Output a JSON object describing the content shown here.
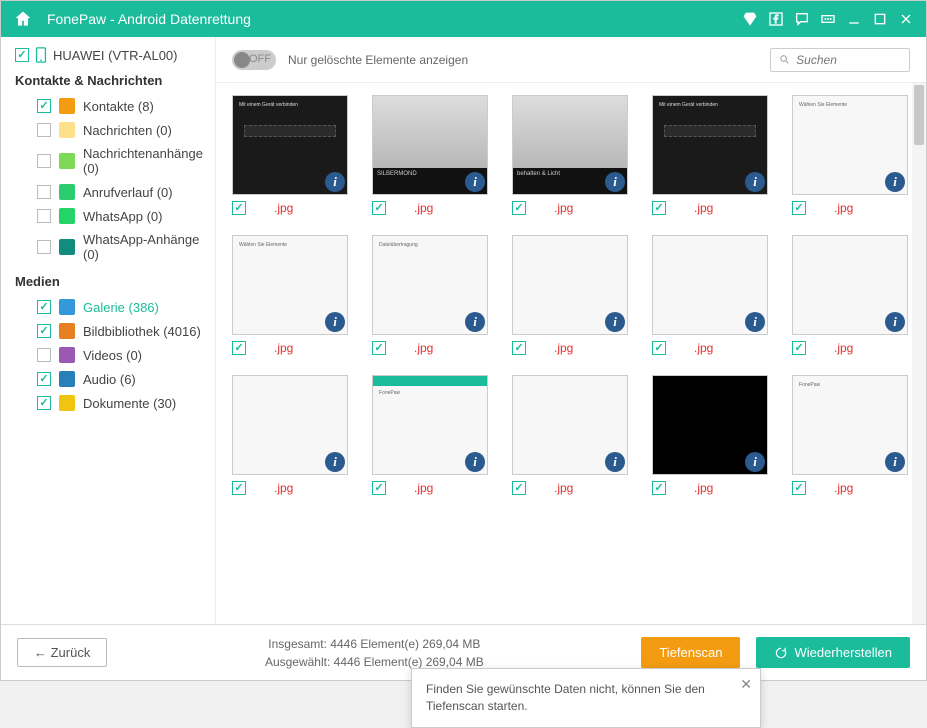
{
  "title": "FonePaw - Android Datenrettung",
  "device": {
    "name": "HUAWEI (VTR-AL00)"
  },
  "sections": {
    "contacts_header": "Kontakte & Nachrichten",
    "media_header": "Medien"
  },
  "categories_contacts": [
    {
      "label": "Kontakte (8)",
      "checked": true,
      "icon": "ic-orange"
    },
    {
      "label": "Nachrichten (0)",
      "checked": false,
      "icon": "ic-yellow"
    },
    {
      "label": "Nachrichtenanhänge (0)",
      "checked": false,
      "icon": "ic-lime"
    },
    {
      "label": "Anrufverlauf (0)",
      "checked": false,
      "icon": "ic-green"
    },
    {
      "label": "WhatsApp (0)",
      "checked": false,
      "icon": "ic-wa"
    },
    {
      "label": "WhatsApp-Anhänge (0)",
      "checked": false,
      "icon": "ic-wa2"
    }
  ],
  "categories_media": [
    {
      "label": "Galerie (386)",
      "checked": true,
      "icon": "ic-gal",
      "selected": true
    },
    {
      "label": "Bildbibliothek (4016)",
      "checked": true,
      "icon": "ic-lib"
    },
    {
      "label": "Videos (0)",
      "checked": false,
      "icon": "ic-vid"
    },
    {
      "label": "Audio (6)",
      "checked": true,
      "icon": "ic-aud"
    },
    {
      "label": "Dokumente (30)",
      "checked": true,
      "icon": "ic-doc"
    }
  ],
  "toggle": {
    "state": "OFF",
    "label": "Nur gelöschte Elemente anzeigen"
  },
  "search_placeholder": "Suchen",
  "thumbs": [
    {
      "ext": ".jpg",
      "variant": "dark",
      "hint": "Mit einem Gerät verbinden"
    },
    {
      "ext": ".jpg",
      "variant": "band",
      "hint": "SILBERMOND"
    },
    {
      "ext": ".jpg",
      "variant": "band",
      "hint": "behalten & Licht"
    },
    {
      "ext": ".jpg",
      "variant": "dark",
      "hint": "Mit einem Gerät verbinden"
    },
    {
      "ext": ".jpg",
      "variant": "light",
      "hint": "Wählen Sie Elemente"
    },
    {
      "ext": ".jpg",
      "variant": "light",
      "hint": "Wählen Sie Elemente"
    },
    {
      "ext": ".jpg",
      "variant": "light",
      "hint": "Dateiübertragung"
    },
    {
      "ext": ".jpg",
      "variant": "light",
      "hint": ""
    },
    {
      "ext": ".jpg",
      "variant": "light",
      "hint": ""
    },
    {
      "ext": ".jpg",
      "variant": "light",
      "hint": ""
    },
    {
      "ext": ".jpg",
      "variant": "light",
      "hint": ""
    },
    {
      "ext": ".jpg",
      "variant": "lighthdr",
      "hint": "FonePaw"
    },
    {
      "ext": ".jpg",
      "variant": "light",
      "hint": ""
    },
    {
      "ext": ".jpg",
      "variant": "black",
      "hint": ""
    },
    {
      "ext": ".jpg",
      "variant": "light",
      "hint": "FonePaw"
    }
  ],
  "footer": {
    "back": "←   Zurück",
    "total_line": "Insgesamt: 4446 Element(e) 269,04 MB",
    "selected_line": "Ausgewählt: 4446 Element(e) 269,04 MB",
    "deepscan": "Tiefenscan",
    "recover": "Wiederherstellen"
  },
  "tooltip": "Finden Sie gewünschte Daten nicht, können Sie den Tiefenscan starten."
}
